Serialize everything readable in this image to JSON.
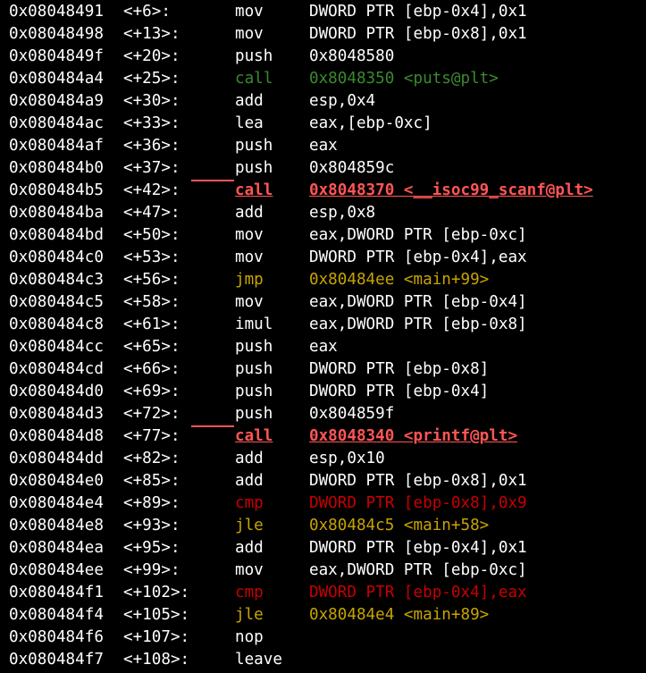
{
  "terminal": {
    "lines": [
      {
        "addr": "0x08048491",
        "off": "<+6>:",
        "mn": "mov",
        "op": "DWORD PTR [ebp-0x4],0x1",
        "cat": "normal"
      },
      {
        "addr": "0x08048498",
        "off": "<+13>:",
        "mn": "mov",
        "op": "DWORD PTR [ebp-0x8],0x1",
        "cat": "normal"
      },
      {
        "addr": "0x0804849f",
        "off": "<+20>:",
        "mn": "push",
        "op": "0x8048580",
        "cat": "normal"
      },
      {
        "addr": "0x080484a4",
        "off": "<+25>:",
        "mn": "call",
        "op": "0x8048350 <puts@plt>",
        "cat": "call"
      },
      {
        "addr": "0x080484a9",
        "off": "<+30>:",
        "mn": "add",
        "op": "esp,0x4",
        "cat": "normal"
      },
      {
        "addr": "0x080484ac",
        "off": "<+33>:",
        "mn": "lea",
        "op": "eax,[ebp-0xc]",
        "cat": "normal"
      },
      {
        "addr": "0x080484af",
        "off": "<+36>:",
        "mn": "push",
        "op": "eax",
        "cat": "normal"
      },
      {
        "addr": "0x080484b0",
        "off": "<+37>:",
        "mn": "push",
        "op": "0x804859c",
        "cat": "normal"
      },
      {
        "addr": "0x080484b5",
        "off": "<+42>:",
        "mn": "call",
        "op": "0x8048370 <__isoc99_scanf@plt>",
        "cat": "hcall"
      },
      {
        "addr": "0x080484ba",
        "off": "<+47>:",
        "mn": "add",
        "op": "esp,0x8",
        "cat": "normal"
      },
      {
        "addr": "0x080484bd",
        "off": "<+50>:",
        "mn": "mov",
        "op": "eax,DWORD PTR [ebp-0xc]",
        "cat": "normal"
      },
      {
        "addr": "0x080484c0",
        "off": "<+53>:",
        "mn": "mov",
        "op": "DWORD PTR [ebp-0x4],eax",
        "cat": "normal"
      },
      {
        "addr": "0x080484c3",
        "off": "<+56>:",
        "mn": "jmp",
        "op": "0x80484ee <main+99>",
        "cat": "jump"
      },
      {
        "addr": "0x080484c5",
        "off": "<+58>:",
        "mn": "mov",
        "op": "eax,DWORD PTR [ebp-0x4]",
        "cat": "normal"
      },
      {
        "addr": "0x080484c8",
        "off": "<+61>:",
        "mn": "imul",
        "op": "eax,DWORD PTR [ebp-0x8]",
        "cat": "normal"
      },
      {
        "addr": "0x080484cc",
        "off": "<+65>:",
        "mn": "push",
        "op": "eax",
        "cat": "normal"
      },
      {
        "addr": "0x080484cd",
        "off": "<+66>:",
        "mn": "push",
        "op": "DWORD PTR [ebp-0x8]",
        "cat": "normal"
      },
      {
        "addr": "0x080484d0",
        "off": "<+69>:",
        "mn": "push",
        "op": "DWORD PTR [ebp-0x4]",
        "cat": "normal"
      },
      {
        "addr": "0x080484d3",
        "off": "<+72>:",
        "mn": "push",
        "op": "0x804859f",
        "cat": "normal"
      },
      {
        "addr": "0x080484d8",
        "off": "<+77>:",
        "mn": "call",
        "op": "0x8048340 <printf@plt>",
        "cat": "hcall"
      },
      {
        "addr": "0x080484dd",
        "off": "<+82>:",
        "mn": "add",
        "op": "esp,0x10",
        "cat": "normal"
      },
      {
        "addr": "0x080484e0",
        "off": "<+85>:",
        "mn": "add",
        "op": "DWORD PTR [ebp-0x8],0x1",
        "cat": "normal"
      },
      {
        "addr": "0x080484e4",
        "off": "<+89>:",
        "mn": "cmp",
        "op": "DWORD PTR [ebp-0x8],0x9",
        "cat": "cmp"
      },
      {
        "addr": "0x080484e8",
        "off": "<+93>:",
        "mn": "jle",
        "op": "0x80484c5 <main+58>",
        "cat": "jump"
      },
      {
        "addr": "0x080484ea",
        "off": "<+95>:",
        "mn": "add",
        "op": "DWORD PTR [ebp-0x4],0x1",
        "cat": "normal"
      },
      {
        "addr": "0x080484ee",
        "off": "<+99>:",
        "mn": "mov",
        "op": "eax,DWORD PTR [ebp-0xc]",
        "cat": "normal"
      },
      {
        "addr": "0x080484f1",
        "off": "<+102>:",
        "mn": "cmp",
        "op": "DWORD PTR [ebp-0x4],eax",
        "cat": "cmp"
      },
      {
        "addr": "0x080484f4",
        "off": "<+105>:",
        "mn": "jle",
        "op": "0x80484e4 <main+89>",
        "cat": "jump"
      },
      {
        "addr": "0x080484f6",
        "off": "<+107>:",
        "mn": "nop",
        "op": "",
        "cat": "normal"
      },
      {
        "addr": "0x080484f7",
        "off": "<+108>:",
        "mn": "leave",
        "op": "",
        "cat": "normal"
      }
    ]
  },
  "colors": {
    "background": "#000000",
    "text": "#ffffff",
    "call": "#3a8a2e",
    "highlighted_call": "#ff5555",
    "jump": "#c8a400",
    "compare": "#c80000"
  }
}
